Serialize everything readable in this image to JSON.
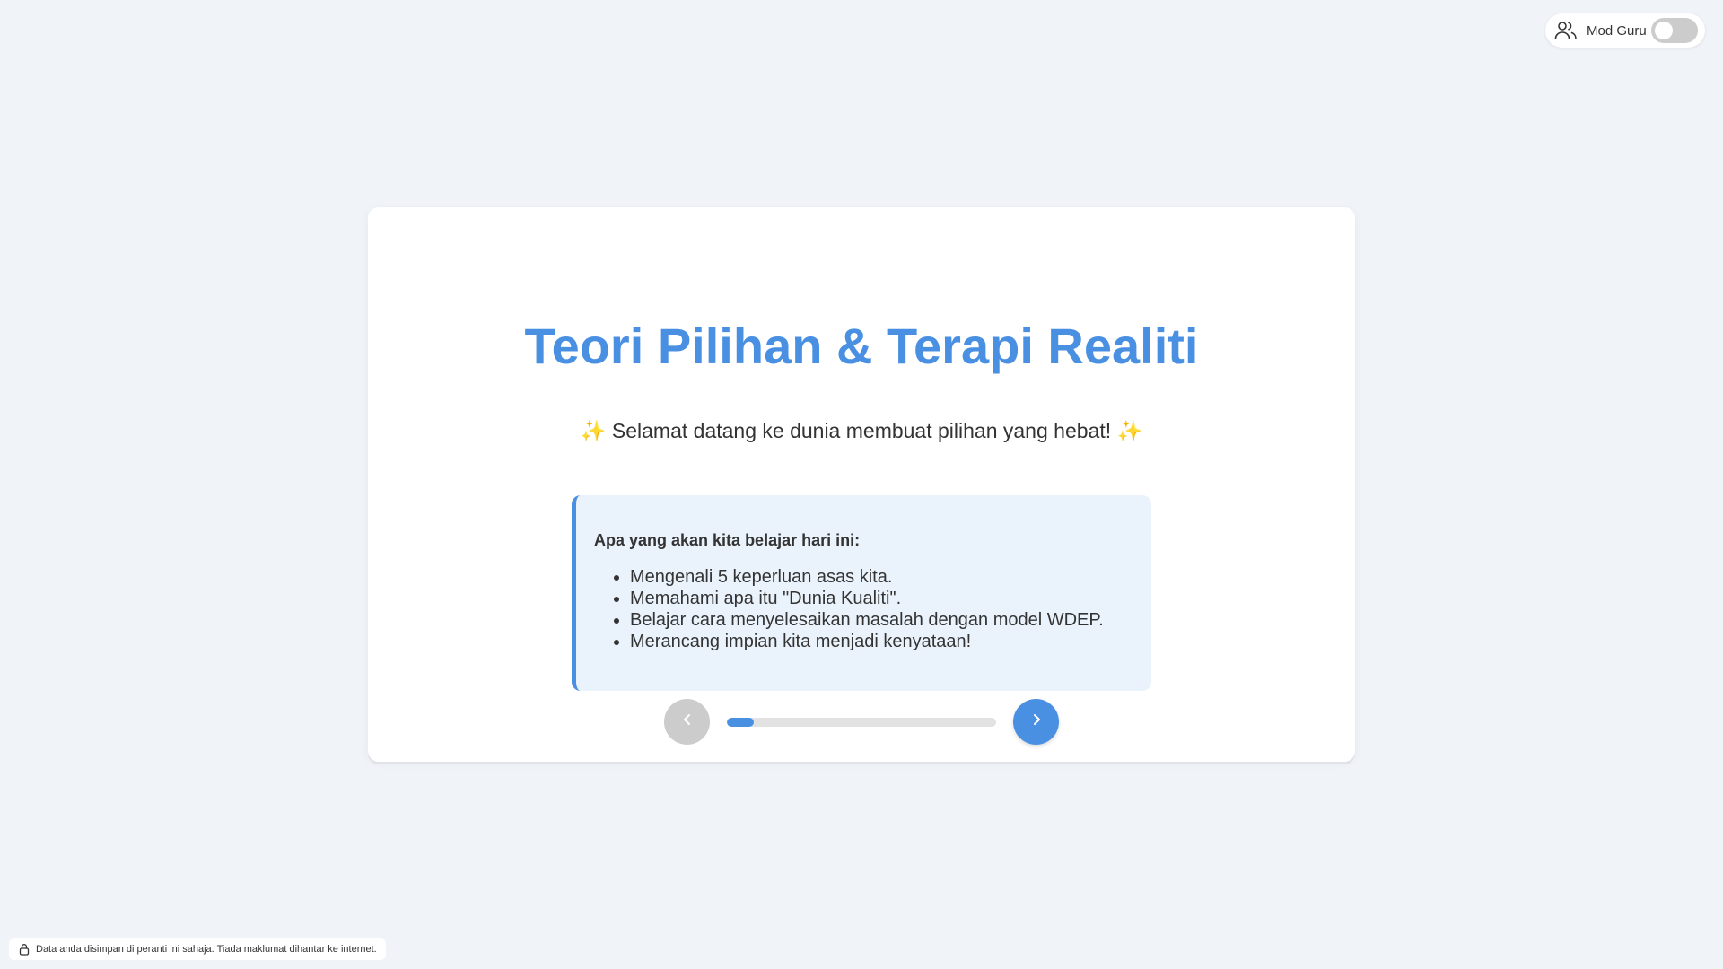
{
  "teacher_mode": {
    "label": "Mod Guru",
    "enabled": false,
    "icon": "users-icon"
  },
  "slide": {
    "title": "Teori Pilihan & Terapi Realiti",
    "subtitle": "✨ Selamat datang ke dunia membuat pilihan yang hebat! ✨",
    "objectives_heading": "Apa yang akan kita belajar hari ini:",
    "objectives": [
      "Mengenali 5 keperluan asas kita.",
      "Memahami apa itu \"Dunia Kualiti\".",
      "Belajar cara menyelesaikan masalah dengan model WDEP.",
      "Merancang impian kita menjadi kenyataan!"
    ]
  },
  "navigation": {
    "prev_icon": "chevron-left-icon",
    "next_icon": "chevron-right-icon",
    "progress_fraction": 0.1,
    "prev_disabled": true
  },
  "footer": {
    "privacy_text": "Data anda disimpan di peranti ini sahaja. Tiada maklumat dihantar ke internet.",
    "icon": "lock-icon"
  },
  "colors": {
    "accent": "#4a90e2",
    "background": "#f0f4f9",
    "disabled": "#cccccc"
  }
}
